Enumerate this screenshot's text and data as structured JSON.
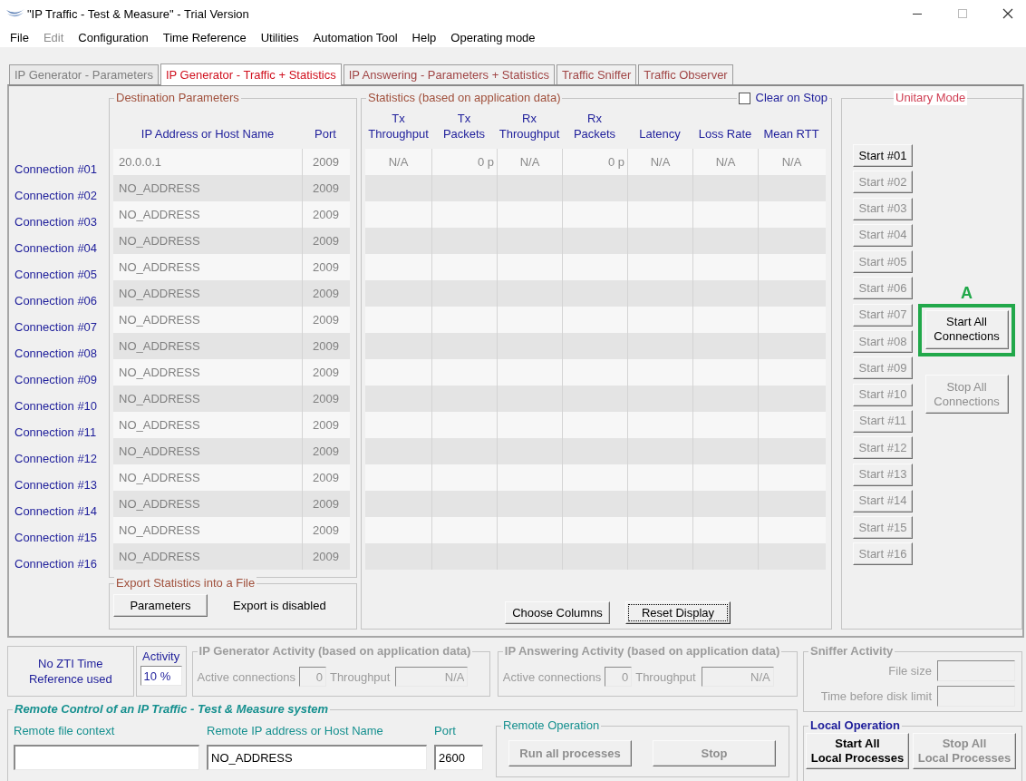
{
  "window": {
    "title": "\"IP Traffic - Test & Measure\" - Trial Version"
  },
  "menu": [
    {
      "label": "File",
      "disabled": false
    },
    {
      "label": "Edit",
      "disabled": true
    },
    {
      "label": "Configuration",
      "disabled": false
    },
    {
      "label": "Time Reference",
      "disabled": false
    },
    {
      "label": "Utilities",
      "disabled": false
    },
    {
      "label": "Automation Tool",
      "disabled": false
    },
    {
      "label": "Help",
      "disabled": false
    },
    {
      "label": "Operating mode",
      "disabled": false
    }
  ],
  "tabs": [
    {
      "label": "IP Generator - Parameters",
      "selected": false,
      "disabled": true
    },
    {
      "label": "IP Generator - Traffic + Statistics",
      "selected": true,
      "disabled": false
    },
    {
      "label": "IP Answering - Parameters + Statistics",
      "selected": false,
      "disabled": false
    },
    {
      "label": "Traffic Sniffer",
      "selected": false,
      "disabled": false
    },
    {
      "label": "Traffic Observer",
      "selected": false,
      "disabled": false
    }
  ],
  "destination": {
    "title": "Destination Parameters",
    "columns": [
      "IP Address or Host Name",
      "Port"
    ]
  },
  "statistics": {
    "title": "Statistics (based on application data)",
    "clear_on_stop": {
      "label": "Clear on Stop",
      "checked": false
    },
    "columns": [
      "Tx\nThroughput",
      "Tx\nPackets",
      "Rx\nThroughput",
      "Rx\nPackets",
      "Latency",
      "Loss Rate",
      "Mean RTT"
    ],
    "buttons": [
      {
        "label": "Choose Columns",
        "focused": false
      },
      {
        "label": "Reset Display",
        "focused": true
      }
    ]
  },
  "connections": [
    {
      "label": "Connection #01",
      "address": "20.0.0.1",
      "port": "2009",
      "stats": [
        "N/A",
        "0 p",
        "N/A",
        "0 p",
        "N/A",
        "N/A",
        "N/A"
      ],
      "start": {
        "label": "Start #01",
        "disabled": false
      }
    },
    {
      "label": "Connection #02",
      "address": "NO_ADDRESS",
      "port": "2009",
      "start": {
        "label": "Start #02",
        "disabled": true
      }
    },
    {
      "label": "Connection #03",
      "address": "NO_ADDRESS",
      "port": "2009",
      "start": {
        "label": "Start #03",
        "disabled": true
      }
    },
    {
      "label": "Connection #04",
      "address": "NO_ADDRESS",
      "port": "2009",
      "start": {
        "label": "Start #04",
        "disabled": true
      }
    },
    {
      "label": "Connection #05",
      "address": "NO_ADDRESS",
      "port": "2009",
      "start": {
        "label": "Start #05",
        "disabled": true
      }
    },
    {
      "label": "Connection #06",
      "address": "NO_ADDRESS",
      "port": "2009",
      "start": {
        "label": "Start #06",
        "disabled": true
      }
    },
    {
      "label": "Connection #07",
      "address": "NO_ADDRESS",
      "port": "2009",
      "start": {
        "label": "Start #07",
        "disabled": true
      }
    },
    {
      "label": "Connection #08",
      "address": "NO_ADDRESS",
      "port": "2009",
      "start": {
        "label": "Start #08",
        "disabled": true
      }
    },
    {
      "label": "Connection #09",
      "address": "NO_ADDRESS",
      "port": "2009",
      "start": {
        "label": "Start #09",
        "disabled": true
      }
    },
    {
      "label": "Connection #10",
      "address": "NO_ADDRESS",
      "port": "2009",
      "start": {
        "label": "Start #10",
        "disabled": true
      }
    },
    {
      "label": "Connection #11",
      "address": "NO_ADDRESS",
      "port": "2009",
      "start": {
        "label": "Start #11",
        "disabled": true
      }
    },
    {
      "label": "Connection #12",
      "address": "NO_ADDRESS",
      "port": "2009",
      "start": {
        "label": "Start #12",
        "disabled": true
      }
    },
    {
      "label": "Connection #13",
      "address": "NO_ADDRESS",
      "port": "2009",
      "start": {
        "label": "Start #13",
        "disabled": true
      }
    },
    {
      "label": "Connection #14",
      "address": "NO_ADDRESS",
      "port": "2009",
      "start": {
        "label": "Start #14",
        "disabled": true
      }
    },
    {
      "label": "Connection #15",
      "address": "NO_ADDRESS",
      "port": "2009",
      "start": {
        "label": "Start #15",
        "disabled": true
      }
    },
    {
      "label": "Connection #16",
      "address": "NO_ADDRESS",
      "port": "2009",
      "start": {
        "label": "Start #16",
        "disabled": true
      }
    }
  ],
  "export": {
    "title": "Export Statistics into a File",
    "button": "Parameters",
    "status": "Export is disabled"
  },
  "unitary_mode": {
    "title": "Unitary Mode",
    "annotation": "A",
    "start_all": {
      "label": "Start All\nConnections",
      "disabled": false,
      "highlighted": true
    },
    "stop_all": {
      "label": "Stop All\nConnections",
      "disabled": true
    }
  },
  "time_reference": {
    "text": "No ZTI Time\nReference used"
  },
  "activity": {
    "label": "Activity",
    "value": "10 %"
  },
  "generator_activity": {
    "title": "IP Generator Activity (based on application data)",
    "disabled": true,
    "fields": [
      {
        "label": "Active connections",
        "value": "0",
        "kind": "short"
      },
      {
        "label": "Throughput",
        "value": "N/A",
        "kind": "wide"
      }
    ]
  },
  "answering_activity": {
    "title": "IP Answering Activity (based on application data)",
    "disabled": true,
    "fields": [
      {
        "label": "Active connections",
        "value": "0",
        "kind": "short"
      },
      {
        "label": "Throughput",
        "value": "N/A",
        "kind": "wide"
      }
    ]
  },
  "sniffer_activity": {
    "title": "Sniffer Activity",
    "disabled": true,
    "fields": [
      {
        "label": "File size"
      },
      {
        "label": "Time before disk limit"
      }
    ]
  },
  "remote_control": {
    "title": "Remote Control of an IP Traffic - Test & Measure system",
    "fields": [
      {
        "label": "Remote file context",
        "kind": "file"
      },
      {
        "label": "Remote IP address or Host Name",
        "value": "NO_ADDRESS",
        "kind": "host"
      },
      {
        "label": "Port",
        "value": "2600",
        "kind": "port"
      }
    ],
    "operation": {
      "title": "Remote Operation",
      "buttons": [
        {
          "label": "Run all processes",
          "disabled": true
        },
        {
          "label": "Stop",
          "disabled": true
        }
      ]
    }
  },
  "local_operation": {
    "title": "Local Operation",
    "buttons": [
      {
        "label": "Start All\nLocal Processes",
        "disabled": false
      },
      {
        "label": "Stop All\nLocal Processes",
        "disabled": true
      }
    ]
  }
}
